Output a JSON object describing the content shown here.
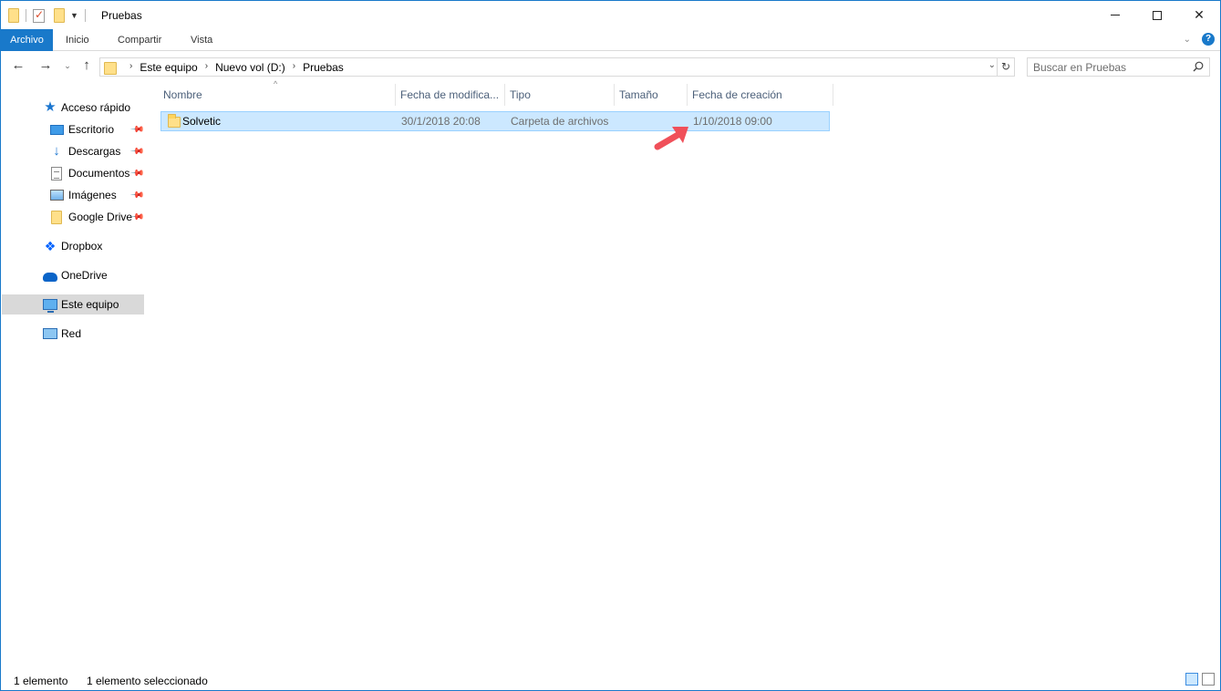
{
  "window": {
    "title": "Pruebas",
    "minimize_icon": "minimize-icon",
    "maximize_icon": "maximize-icon",
    "close_glyph": "✕"
  },
  "ribbon": {
    "tabs": [
      {
        "label": "Archivo",
        "active": true
      },
      {
        "label": "Inicio"
      },
      {
        "label": "Compartir"
      },
      {
        "label": "Vista"
      }
    ],
    "accent": "#1979ca"
  },
  "address": {
    "crumbs": [
      "Este equipo",
      "Nuevo vol (D:)",
      "Pruebas"
    ]
  },
  "search": {
    "placeholder": "Buscar en Pruebas"
  },
  "nav": {
    "quick_access": "Acceso rápido",
    "items": [
      {
        "label": "Escritorio",
        "icon": "desktop-icon",
        "pinned": true
      },
      {
        "label": "Descargas",
        "icon": "downloads-icon",
        "pinned": true
      },
      {
        "label": "Documentos",
        "icon": "documents-icon",
        "pinned": true
      },
      {
        "label": "Imágenes",
        "icon": "pictures-icon",
        "pinned": true
      },
      {
        "label": "Google Drive",
        "icon": "folder-icon",
        "pinned": true
      }
    ],
    "dropbox": "Dropbox",
    "onedrive": "OneDrive",
    "this_pc": "Este equipo",
    "network": "Red"
  },
  "files": {
    "columns": [
      "Nombre",
      "Fecha de modifica...",
      "Tipo",
      "Tamaño",
      "Fecha de creación"
    ],
    "rows": [
      {
        "name": "Solvetic",
        "modified": "30/1/2018 20:08",
        "type": "Carpeta de archivos",
        "size": "",
        "created": "1/10/2018 09:00",
        "selected": true
      }
    ]
  },
  "status": {
    "count": "1 elemento",
    "selected": "1 elemento seleccionado"
  },
  "annotation": {
    "color": "#f0505a"
  }
}
